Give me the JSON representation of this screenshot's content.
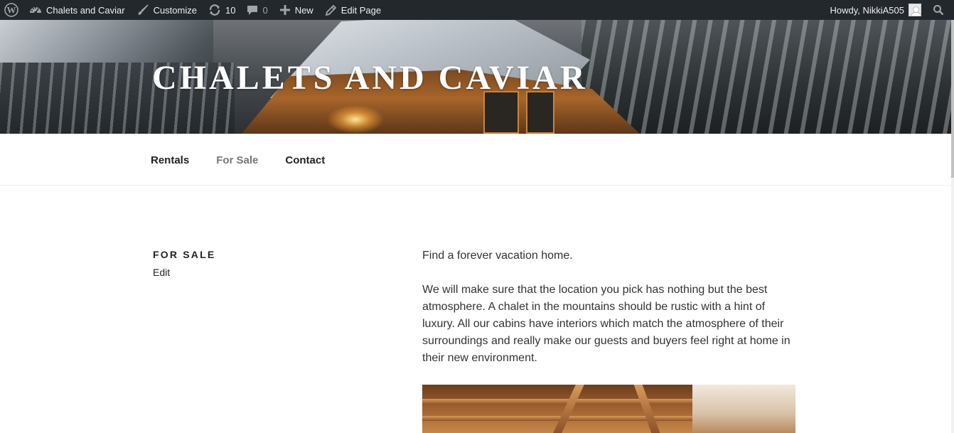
{
  "adminbar": {
    "site_name": "Chalets and Caviar",
    "customize": "Customize",
    "updates_count": "10",
    "comments_count": "0",
    "new_label": "New",
    "edit_page": "Edit Page",
    "greeting": "Howdy, NikkiA505",
    "icons": [
      "wordpress-icon",
      "dashboard-icon",
      "brush-icon",
      "updates-icon",
      "comment-icon",
      "plus-icon",
      "pencil-icon",
      "search-icon"
    ]
  },
  "header": {
    "site_title": "CHALETS AND CAVIAR"
  },
  "nav": {
    "items": [
      {
        "label": "Rentals",
        "current": false
      },
      {
        "label": "For Sale",
        "current": true
      },
      {
        "label": "Contact",
        "current": false
      }
    ]
  },
  "page": {
    "title": "FOR SALE",
    "edit_link": "Edit",
    "paragraphs": [
      "Find a forever vacation home.",
      "We will make sure that the location you pick has nothing but the best atmosphere. A chalet in the mountains should be rustic with a hint of luxury. All our cabins have interiors which match the atmosphere of their surroundings and really make our guests and buyers feel right at home in their new environment."
    ]
  },
  "colors": {
    "adminbar_bg": "#23282d",
    "nav_current": "#767676",
    "text": "#333333"
  }
}
